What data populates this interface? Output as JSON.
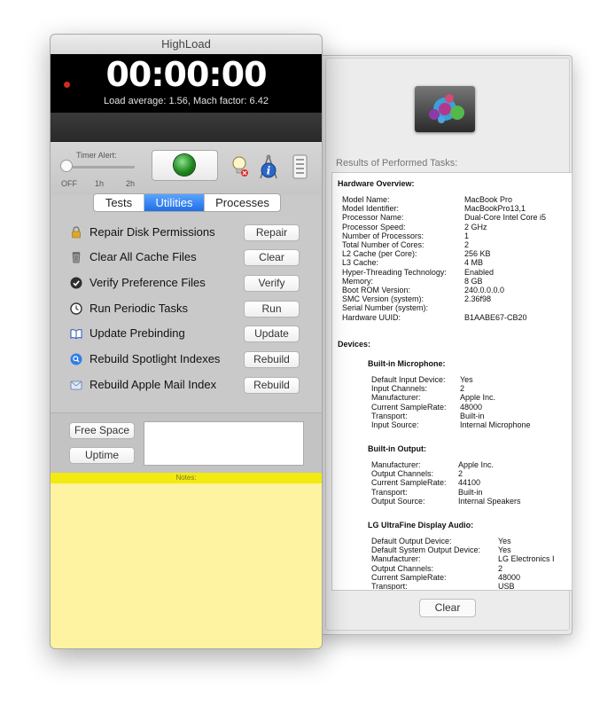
{
  "window": {
    "title": "HighLoad"
  },
  "monitor": {
    "timer": "00:00:00",
    "load_text": "Load average: 1.56, Mach factor: 6.42"
  },
  "timer_alert": {
    "label": "Timer Alert:",
    "ticks": [
      "OFF",
      "1h",
      "2h"
    ],
    "selected": "OFF"
  },
  "tabs": [
    {
      "label": "Tests",
      "active": false
    },
    {
      "label": "Utilities",
      "active": true
    },
    {
      "label": "Processes",
      "active": false
    }
  ],
  "utilities": [
    {
      "label": "Repair Disk Permissions",
      "button": "Repair",
      "icon": "lock-icon"
    },
    {
      "label": "Clear All Cache Files",
      "button": "Clear",
      "icon": "trash-icon"
    },
    {
      "label": "Verify Preference Files",
      "button": "Verify",
      "icon": "checkmark-icon"
    },
    {
      "label": "Run Periodic Tasks",
      "button": "Run",
      "icon": "clock-icon"
    },
    {
      "label": "Update Prebinding",
      "button": "Update",
      "icon": "book-icon"
    },
    {
      "label": "Rebuild Spotlight Indexes",
      "button": "Rebuild",
      "icon": "spotlight-icon"
    },
    {
      "label": "Rebuild Apple Mail Index",
      "button": "Rebuild",
      "icon": "mail-icon"
    }
  ],
  "bottom_buttons": {
    "free_space": "Free Space",
    "uptime": "Uptime"
  },
  "notes": {
    "label": "Notes:"
  },
  "results": {
    "title": "Results of Performed Tasks:",
    "hardware_title": "Hardware Overview:",
    "hardware": [
      [
        "Model Name:",
        "MacBook Pro"
      ],
      [
        "Model Identifier:",
        "MacBookPro13,1"
      ],
      [
        "Processor Name:",
        "Dual-Core Intel Core i5"
      ],
      [
        "Processor Speed:",
        "2 GHz"
      ],
      [
        "Number of Processors:",
        "1"
      ],
      [
        "Total Number of Cores:",
        "2"
      ],
      [
        "L2 Cache (per Core):",
        "256 KB"
      ],
      [
        "L3 Cache:",
        "4 MB"
      ],
      [
        "Hyper-Threading Technology:",
        "Enabled"
      ],
      [
        "Memory:",
        "8 GB"
      ],
      [
        "Boot ROM Version:",
        "240.0.0.0.0"
      ],
      [
        "SMC Version (system):",
        "2.36f98"
      ],
      [
        "Serial Number (system):",
        ""
      ],
      [
        "Hardware UUID:",
        "B1AABE67-CB20"
      ]
    ],
    "devices_title": "Devices:",
    "devices": [
      {
        "name": "Built-in Microphone:",
        "props": [
          [
            "Default Input Device:",
            "Yes"
          ],
          [
            "Input Channels:",
            "2"
          ],
          [
            "Manufacturer:",
            "Apple Inc."
          ],
          [
            "Current SampleRate:",
            "48000"
          ],
          [
            "Transport:",
            "Built-in"
          ],
          [
            "Input Source:",
            "Internal Microphone"
          ]
        ]
      },
      {
        "name": "Built-in Output:",
        "props": [
          [
            "Manufacturer:",
            "Apple Inc."
          ],
          [
            "Output Channels:",
            "2"
          ],
          [
            "Current SampleRate:",
            "44100"
          ],
          [
            "Transport:",
            "Built-in"
          ],
          [
            "Output Source:",
            "Internal Speakers"
          ]
        ]
      },
      {
        "name": "LG UltraFine Display Audio:",
        "props": [
          [
            "Default Output Device:",
            "Yes"
          ],
          [
            "Default System Output Device:",
            "Yes"
          ],
          [
            "Manufacturer:",
            "LG Electronics I"
          ],
          [
            "Output Channels:",
            "2"
          ],
          [
            "Current SampleRate:",
            "48000"
          ],
          [
            "Transport:",
            "USB"
          ]
        ]
      }
    ],
    "clear_label": "Clear"
  },
  "colors": {
    "accent": "#1f6fe6",
    "notes_bar": "#f3ea10",
    "notes_bg": "#fdf3a0",
    "record_dot": "#d22b1e"
  }
}
